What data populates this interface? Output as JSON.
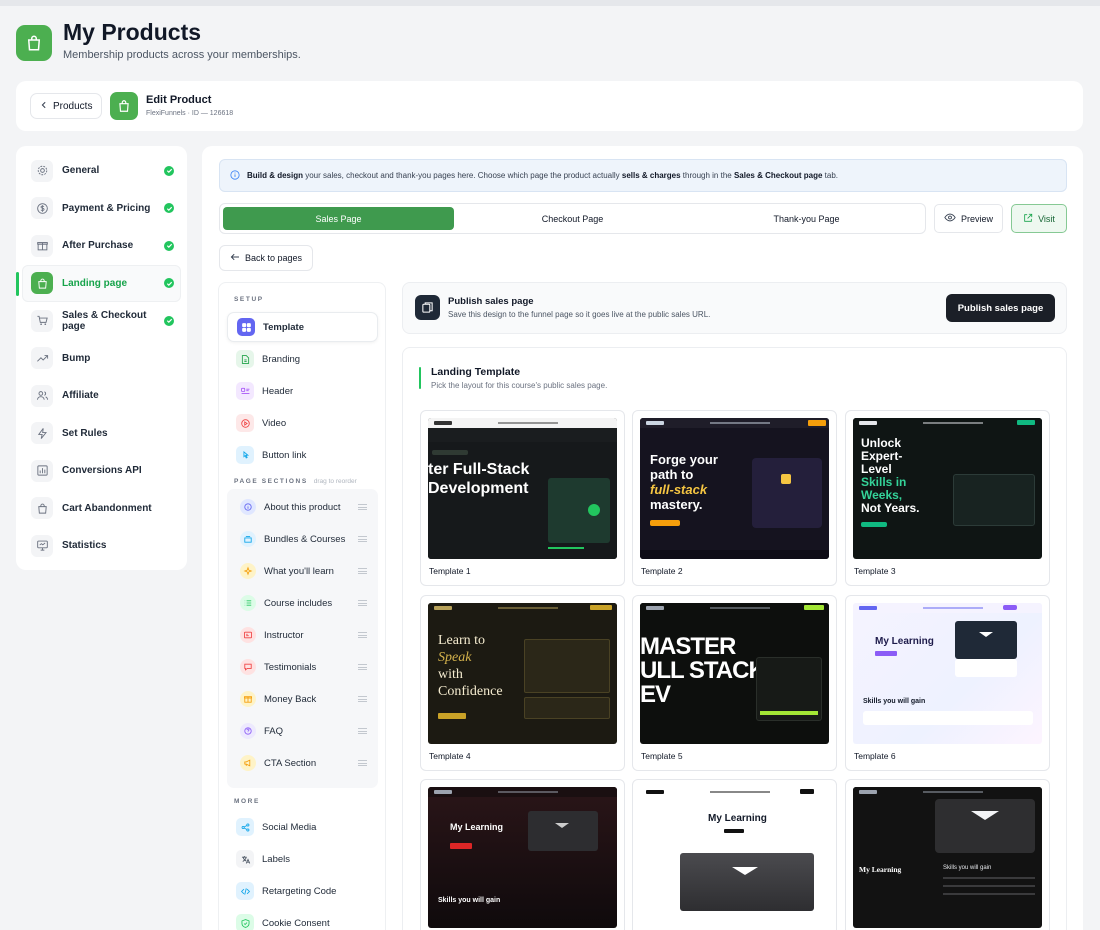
{
  "header": {
    "title": "My Products",
    "subtitle": "Membership products across your memberships."
  },
  "editbar": {
    "back_label": "Products",
    "title": "Edit Product",
    "subtitle": "FlexiFunnels · ID — 126618"
  },
  "leftnav": {
    "items": [
      {
        "label": "General",
        "icon": "gear-icon",
        "done": true
      },
      {
        "label": "Payment & Pricing",
        "icon": "dollar-icon",
        "done": true
      },
      {
        "label": "After Purchase",
        "icon": "gift-icon",
        "done": true
      },
      {
        "label": "Landing page",
        "icon": "bag-icon",
        "done": true,
        "active": true
      },
      {
        "label": "Sales & Checkout page",
        "icon": "cart-icon",
        "done": true
      },
      {
        "label": "Bump",
        "icon": "trend-icon",
        "done": false
      },
      {
        "label": "Affiliate",
        "icon": "users-icon",
        "done": false
      },
      {
        "label": "Set Rules",
        "icon": "bolt-icon",
        "done": false
      },
      {
        "label": "Conversions API",
        "icon": "bar-chart-icon",
        "done": false
      },
      {
        "label": "Cart Abandonment",
        "icon": "bag-icon",
        "done": false
      },
      {
        "label": "Statistics",
        "icon": "monitor-icon",
        "done": false
      }
    ]
  },
  "banner": {
    "b1": "Build & design",
    "t1": " your sales, checkout and thank-you pages here. Choose which page the product actually ",
    "b2": "sells & charges",
    "t2": " through in the ",
    "b3": "Sales & Checkout page",
    "t3": " tab."
  },
  "tabs": [
    "Sales Page",
    "Checkout Page",
    "Thank-you Page"
  ],
  "actions": {
    "preview": "Preview",
    "visit": "Visit",
    "back_pages": "Back to pages"
  },
  "setup": {
    "setup_heading": "SETUP",
    "setup_items": [
      "Template",
      "Branding",
      "Header",
      "Video",
      "Button link"
    ],
    "sections_heading": "PAGE SECTIONS",
    "sections_hint": "drag to reorder",
    "sections": [
      "About this product",
      "Bundles & Courses",
      "What you'll learn",
      "Course includes",
      "Instructor",
      "Testimonials",
      "Money Back",
      "FAQ",
      "CTA Section"
    ],
    "more_heading": "MORE",
    "more_items": [
      "Social Media",
      "Labels",
      "Retargeting Code",
      "Cookie Consent"
    ]
  },
  "publish": {
    "title": "Publish sales page",
    "subtitle": "Save this design to the funnel page so it goes live at the public sales URL.",
    "button": "Publish sales page"
  },
  "templates": {
    "title": "Landing Template",
    "subtitle": "Pick the layout for this course's public sales page.",
    "items": [
      {
        "label": "Template 1"
      },
      {
        "label": "Template 2"
      },
      {
        "label": "Template 3"
      },
      {
        "label": "Template 4"
      },
      {
        "label": "Template 5"
      },
      {
        "label": "Template 6"
      },
      {
        "label": ""
      },
      {
        "label": ""
      },
      {
        "label": ""
      }
    ],
    "thumb_text": {
      "t1a": "ter Full-Stack",
      "t1b": "Development",
      "t2a": "Forge your",
      "t2b": "path to",
      "t2c": "full-stack",
      "t2d": "mastery.",
      "t3a": "Unlock",
      "t3b": "Expert-",
      "t3c": "Level",
      "t3d": "Skills in",
      "t3e": "Weeks,",
      "t3f": "Not Years.",
      "t4a": "Learn to",
      "t4b": "Speak",
      "t4c": "with",
      "t4d": "Confidence",
      "t5a": "MASTER",
      "t5b": "ULL STACK",
      "t5c": "EV",
      "t6a": "My Learning",
      "t6b": "Skills you will gain",
      "t7a": "My Learning",
      "t7b": "Skills you will gain",
      "t8a": "My Learning",
      "t9a": "My Learning",
      "t9b": "Skills you will gain"
    }
  },
  "colors": {
    "accent": "#4caf50",
    "tab_active": "#3f9a4e",
    "check": "#22c55e",
    "dark": "#1b1f27"
  }
}
